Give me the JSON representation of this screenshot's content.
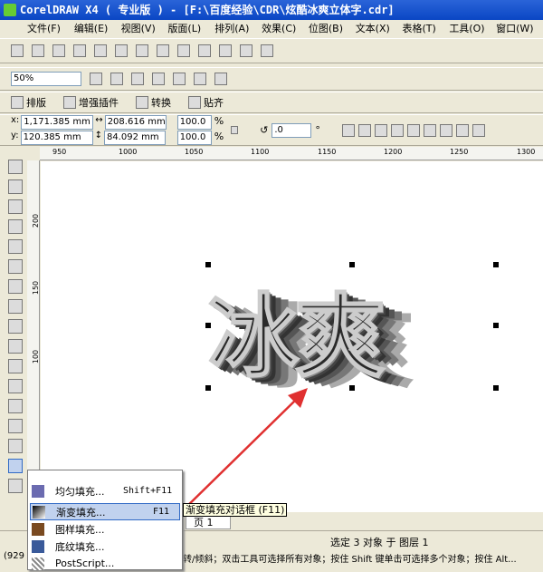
{
  "title": "CorelDRAW X4 ( 专业版 ) - [F:\\百度经验\\CDR\\炫酷冰爽立体字.cdr]",
  "menu": [
    "文件(F)",
    "编辑(E)",
    "视图(V)",
    "版面(L)",
    "排列(A)",
    "效果(C)",
    "位图(B)",
    "文本(X)",
    "表格(T)",
    "工具(O)",
    "窗口(W)"
  ],
  "zoom": {
    "value": "50%"
  },
  "plugins": [
    "排版",
    "增强插件",
    "转换",
    "贴齐"
  ],
  "props": {
    "x": "1,171.385 mm",
    "y": "120.385 mm",
    "w": "208.616 mm",
    "h": "84.092 mm",
    "sx": "100.0",
    "sy": "100.0",
    "pct": "%",
    "angle": ".0",
    "deg": "°",
    "xl": "x:",
    "yl": "y:"
  },
  "ruler_h": [
    "950",
    "1000",
    "1050",
    "1100",
    "1150",
    "1200",
    "1250",
    "1300"
  ],
  "ruler_v": [
    "200",
    "150",
    "100"
  ],
  "art_text": "冰爽",
  "flyout": [
    {
      "label": "均匀填充...",
      "shortcut": "Shift+F11",
      "color": "#6b6bb0"
    },
    {
      "label": "渐变填充...",
      "shortcut": "F11",
      "color": "#333"
    },
    {
      "label": "图样填充...",
      "shortcut": "",
      "color": "#7a4a20"
    },
    {
      "label": "底纹填充...",
      "shortcut": "",
      "color": "#3a5a9a"
    },
    {
      "label": "PostScript...",
      "shortcut": "",
      "color": "#888"
    }
  ],
  "tooltip": "渐变填充对话框 (F11)",
  "page_tab": "页 1",
  "status": {
    "selection": "选定 3 对象 于 图层 1",
    "coords": "(929",
    "hint": "转/倾斜；双击工具可选择所有对象；按住 Shift 键单击可选择多个对象；按住 Alt..."
  }
}
